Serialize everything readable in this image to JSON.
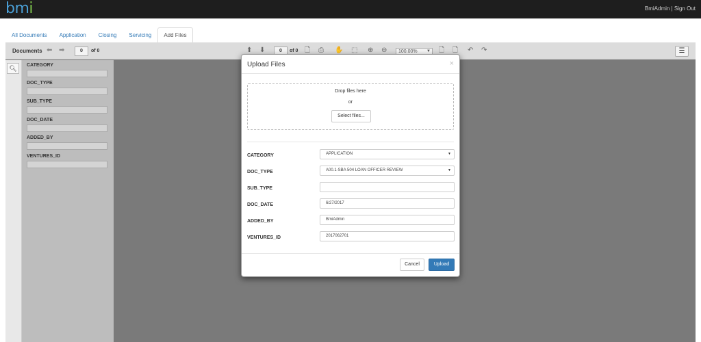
{
  "header": {
    "logo_text": "bm",
    "logo_dot": "i",
    "user": "BmiAdmin",
    "separator": "|",
    "sign_out": "Sign Out"
  },
  "tabs": [
    {
      "label": "All Documents"
    },
    {
      "label": "Application"
    },
    {
      "label": "Closing"
    },
    {
      "label": "Servicing"
    },
    {
      "label": "Add Files"
    }
  ],
  "toolbar": {
    "title": "Documents",
    "left_page": "0",
    "left_of": "of 0",
    "center_page": "0",
    "center_of": "of 0",
    "zoom": "100.00%"
  },
  "filters": {
    "items": [
      {
        "label": "CATEGORY"
      },
      {
        "label": "DOC_TYPE"
      },
      {
        "label": "SUB_TYPE"
      },
      {
        "label": "DOC_DATE"
      },
      {
        "label": "ADDED_BY"
      },
      {
        "label": "VENTURES_ID"
      }
    ]
  },
  "modal": {
    "title": "Upload Files",
    "close": "×",
    "drop_text": "Drop files here",
    "or_text": "or",
    "select_files": "Select files...",
    "fields": [
      {
        "label": "CATEGORY",
        "value": "APPLICATION"
      },
      {
        "label": "DOC_TYPE",
        "value": "A00.1-SBA 504 LOAN OFFICER REVIEW"
      },
      {
        "label": "SUB_TYPE",
        "value": ""
      },
      {
        "label": "DOC_DATE",
        "value": "6/27/2017"
      },
      {
        "label": "ADDED_BY",
        "value": "BmiAdmin"
      },
      {
        "label": "VENTURES_ID",
        "value": "2017062701"
      }
    ],
    "cancel": "Cancel",
    "upload": "Upload"
  },
  "colors": {
    "accent": "#337ab7",
    "logo": "#4a9fd6",
    "topbar": "#1e1e1e"
  }
}
